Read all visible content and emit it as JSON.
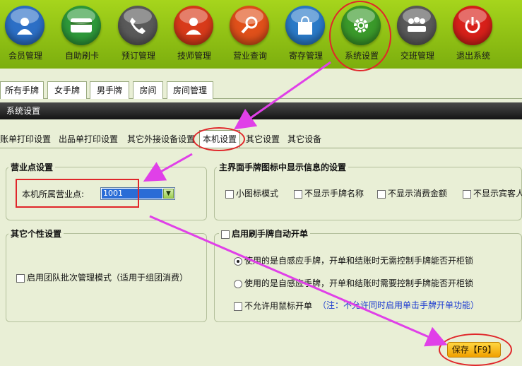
{
  "toolbar": {
    "items": [
      {
        "label": "会员管理",
        "icon": "member-icon",
        "color": "#2c6fc6"
      },
      {
        "label": "自助刷卡",
        "icon": "card-icon",
        "color": "#2e9a3a"
      },
      {
        "label": "预订管理",
        "icon": "phone-icon",
        "color": "#5a5a5a"
      },
      {
        "label": "技师管理",
        "icon": "technician-icon",
        "color": "#d83a1a"
      },
      {
        "label": "营业查询",
        "icon": "magnifier-icon",
        "color": "#e0501a"
      },
      {
        "label": "寄存管理",
        "icon": "bag-icon",
        "color": "#2a7ac8"
      },
      {
        "label": "系统设置",
        "icon": "gear-icon",
        "color": "#3a9a2a"
      },
      {
        "label": "交班管理",
        "icon": "meeting-icon",
        "color": "#5a5a5a"
      },
      {
        "label": "退出系统",
        "icon": "power-icon",
        "color": "#d8201a"
      }
    ]
  },
  "tabs": [
    "所有手牌",
    "女手牌",
    "男手牌",
    "房间",
    "房间管理"
  ],
  "section_title": "系统设置",
  "subtabs": [
    "账单打印设置",
    "出品单打印设置",
    "其它外接设备设置",
    "本机设置",
    "其它设置",
    "其它设备"
  ],
  "business_point": {
    "title": "营业点设置",
    "label": "本机所属营业点:",
    "selected": "1001"
  },
  "main_display": {
    "title": "主界面手牌图标中显示信息的设置",
    "options": [
      "小图标模式",
      "不显示手牌名称",
      "不显示消费金额",
      "不显示宾客人"
    ]
  },
  "personal": {
    "title": "其它个性设置",
    "option": "启用团队批次管理模式（适用于组团消费）"
  },
  "auto_open": {
    "title": "启用刷手牌自动开单",
    "radio1": "使用的是自感应手牌，开单和结账时无需控制手牌能否开柜锁",
    "radio2": "使用的是自感应手牌，开单和结账时需要控制手牌能否开柜锁",
    "mouse_option": "不允许用鼠标开单",
    "note": "（注：不允许同时启用单击手牌开单功能）"
  },
  "save_label": "保存【F9】",
  "colors": {
    "accent": "#e0262a",
    "arrow": "#e040e8",
    "toolbar": "#8fc214"
  }
}
